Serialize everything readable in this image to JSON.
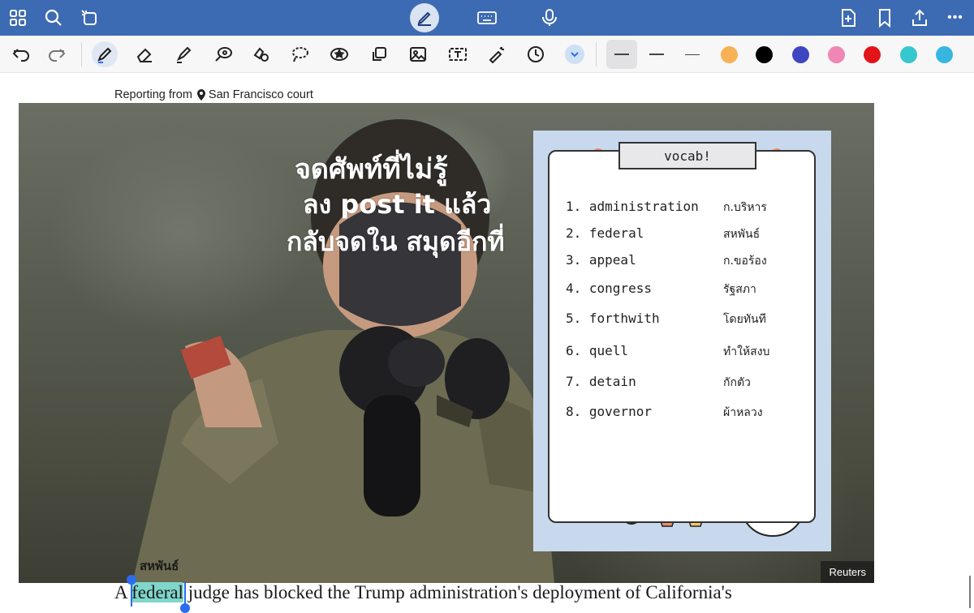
{
  "topbar": {
    "left_icons": [
      "grid-icon",
      "search-icon",
      "magic-select-icon"
    ],
    "center_icons": [
      "pen-mode-icon",
      "keyboard-icon",
      "microphone-icon"
    ],
    "right_icons": [
      "add-page-icon",
      "bookmark-icon",
      "share-icon",
      "more-icon"
    ],
    "more_label": "•••"
  },
  "toolbar": {
    "tools": [
      "undo-icon",
      "redo-icon",
      "pen-icon",
      "eraser-icon",
      "highlighter-icon",
      "shape-icon",
      "lasso-icon",
      "lasso-freeform-icon",
      "sticker-icon",
      "copy-icon",
      "image-icon",
      "text-box-icon",
      "laser-pointer-icon",
      "history-icon"
    ],
    "colors": [
      "#f8b155",
      "#000000",
      "#3d45c0",
      "#ef86b3",
      "#e3131a",
      "#36c7cf",
      "#36b6e0"
    ]
  },
  "doc": {
    "reporting_prefix": "Reporting from",
    "reporting_location": "San Francisco court",
    "photo_credit": "Reuters",
    "handwritten_note_lines": [
      "จดศัพท์ที่ไม่รู้",
      "ลง post it แล้ว",
      "กลับจดใน สมุดอีกที่"
    ],
    "vocab": {
      "title": "vocab!",
      "items": [
        {
          "en": "1. administration",
          "th": "ก.บริหาร"
        },
        {
          "en": "2. federal",
          "th": "สหพันธ์"
        },
        {
          "en": "3. appeal",
          "th": "ก.ขอร้อง"
        },
        {
          "en": "4. congress",
          "th": "รัฐสภา"
        },
        {
          "en": "5. forthwith",
          "th": "โดยทันที"
        },
        {
          "en": "6. quell",
          "th": "ทำให้สงบ"
        },
        {
          "en": "7. detain",
          "th": "กักตัว"
        },
        {
          "en": "8. governor",
          "th": "ผ้าหลวง"
        }
      ]
    },
    "annotation": "สหพันธ์",
    "article": {
      "before": "A ",
      "highlight": "federal",
      "after": " judge has blocked the Trump administration's deployment of California's"
    }
  }
}
